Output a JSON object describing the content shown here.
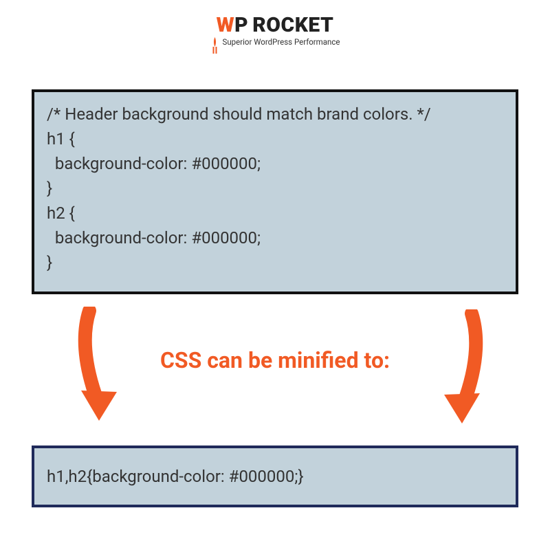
{
  "brand": {
    "logo_w": "W",
    "logo_p": "P",
    "logo_rocket": "ROCKET",
    "tagline": "Superior WordPress Performance",
    "accent": "#F15A24"
  },
  "code_before": "/* Header background should match brand colors. */\nh1 {\n  background-color: #000000;\n}\nh2 {\n  background-color: #000000;\n}",
  "caption": "CSS can be minified to:",
  "code_after": "h1,h2{background-color: #000000;}",
  "icons": {
    "arrow": "arrow-down-icon",
    "rocket": "rocket-icon"
  }
}
